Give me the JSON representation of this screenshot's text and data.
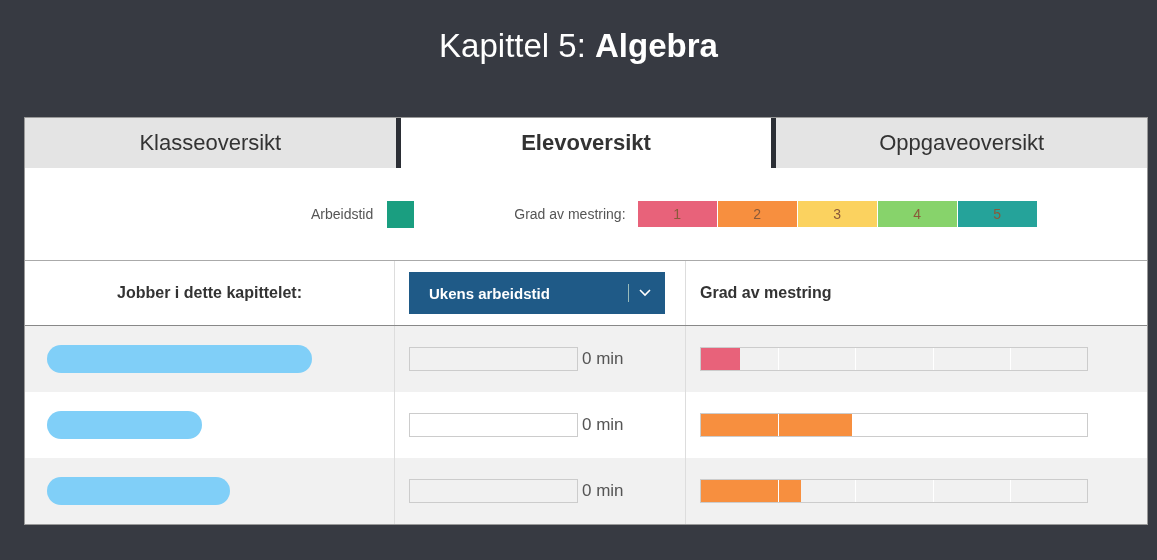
{
  "title": {
    "prefix": "Kapittel 5: ",
    "name": "Algebra"
  },
  "tabs": [
    {
      "label": "Klasseoversikt",
      "selected": false
    },
    {
      "label": "Elevoversikt",
      "selected": true
    },
    {
      "label": "Oppgaveoversikt",
      "selected": false
    }
  ],
  "legend": {
    "time_label": "Arbeidstid",
    "mastery_label": "Grad av mestring:",
    "levels": [
      {
        "label": "1",
        "color": "#e8627a"
      },
      {
        "label": "2",
        "color": "#f78f3f"
      },
      {
        "label": "3",
        "color": "#fbd25f"
      },
      {
        "label": "4",
        "color": "#87d36b"
      },
      {
        "label": "5",
        "color": "#25a39a"
      }
    ]
  },
  "table": {
    "column_1": "Jobber i dette kapittelet:",
    "dropdown": "Ukens arbeidstid",
    "column_3": "Grad av mestring",
    "rows": [
      {
        "time_bar": {
          "level": 0
        },
        "time": "0 min",
        "level": 0.1,
        "color": "#e8627a"
      },
      {
        "time_bar": {
          "level": 0
        },
        "time": "0 min",
        "level": 0.39,
        "color": "#f78f3f"
      },
      {
        "time_bar": {
          "level": 0
        },
        "time": "0 min",
        "level": 0.26,
        "color": "#f78f3f"
      }
    ]
  }
}
